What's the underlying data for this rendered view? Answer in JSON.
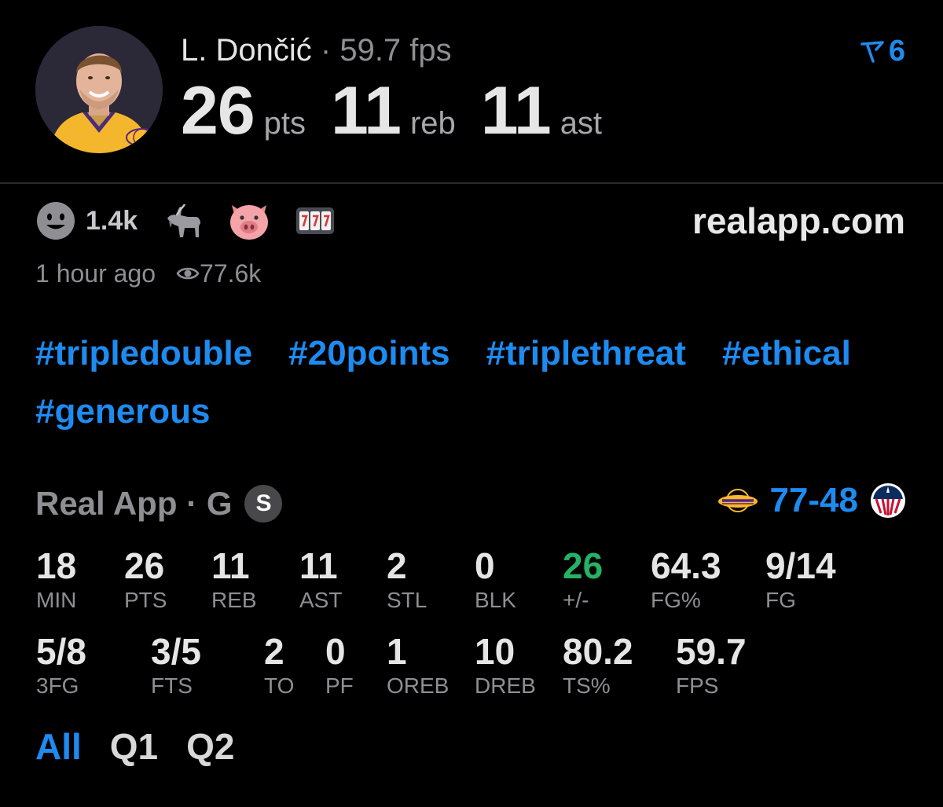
{
  "header": {
    "player_name": "L. Dončić",
    "separator": "·",
    "fps_text": "59.7 fps",
    "boost_count": "6",
    "stats": [
      {
        "value": "26",
        "label": "pts"
      },
      {
        "value": "11",
        "label": "reb"
      },
      {
        "value": "11",
        "label": "ast"
      }
    ]
  },
  "reactions": {
    "smile_count": "1.4k",
    "icons": [
      "smile-emoji",
      "goat-emoji",
      "pig-emoji",
      "slot-machine-777-emoji"
    ]
  },
  "site": "realapp.com",
  "meta": {
    "time_ago": "1 hour ago",
    "views": "77.6k"
  },
  "tags": [
    "#tripledouble",
    "#20points",
    "#triplethreat",
    "#ethical",
    "#generous"
  ],
  "game": {
    "source": "Real App",
    "separator": "·",
    "position": "G",
    "badge": "S",
    "score": "77-48",
    "home_team_icon": "lakers-logo",
    "away_team_icon": "wizards-logo"
  },
  "stats_rows": [
    [
      {
        "value": "18",
        "label": "MIN"
      },
      {
        "value": "26",
        "label": "PTS"
      },
      {
        "value": "11",
        "label": "REB"
      },
      {
        "value": "11",
        "label": "AST"
      },
      {
        "value": "2",
        "label": "STL"
      },
      {
        "value": "0",
        "label": "BLK"
      },
      {
        "value": "26",
        "label": "+/-"
      },
      {
        "value": "64.3",
        "label": "FG%"
      },
      {
        "value": "9/14",
        "label": "FG"
      }
    ],
    [
      {
        "value": "5/8",
        "label": "3FG"
      },
      {
        "value": "3/5",
        "label": "FTS"
      },
      {
        "value": "2",
        "label": "TO"
      },
      {
        "value": "0",
        "label": "PF"
      },
      {
        "value": "1",
        "label": "OREB"
      },
      {
        "value": "10",
        "label": "DREB"
      },
      {
        "value": "80.2",
        "label": "TS%"
      },
      {
        "value": "59.7",
        "label": "FPS"
      }
    ]
  ],
  "tabs": [
    {
      "label": "All",
      "active": true
    },
    {
      "label": "Q1",
      "active": false
    },
    {
      "label": "Q2",
      "active": false
    }
  ],
  "colors": {
    "accent": "#1e8bf0",
    "positive": "#25b266",
    "muted": "#8e8e93",
    "background": "#000000"
  }
}
